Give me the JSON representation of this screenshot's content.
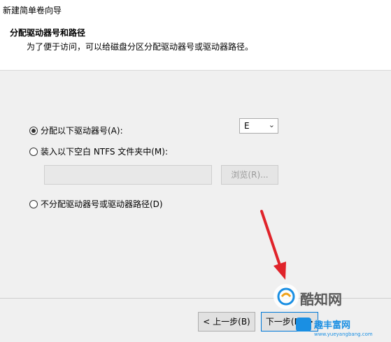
{
  "window": {
    "title": "新建简单卷向导"
  },
  "header": {
    "title": "分配驱动器号和路径",
    "subtitle": "为了便于访问，可以给磁盘分区分配驱动器号或驱动器路径。"
  },
  "options": {
    "assign_letter": {
      "label": "分配以下驱动器号(A):",
      "selected": true
    },
    "mount_folder": {
      "label": "装入以下空白 NTFS 文件夹中(M):",
      "selected": false
    },
    "no_assign": {
      "label": "不分配驱动器号或驱动器路径(D)",
      "selected": false
    }
  },
  "drive_letter": {
    "value": "E"
  },
  "folder_path": {
    "value": ""
  },
  "browse_button": {
    "label": "浏览(R)..."
  },
  "footer": {
    "back_label": "< 上一步(B)",
    "next_label": "下一步(N) >"
  },
  "watermark": {
    "brand": "酷知网",
    "site_name": "趣丰富网",
    "site_url": "www.yueyangbang.com"
  },
  "colors": {
    "arrow": "#e0232a",
    "watermark_blue": "#1a8fe3"
  }
}
